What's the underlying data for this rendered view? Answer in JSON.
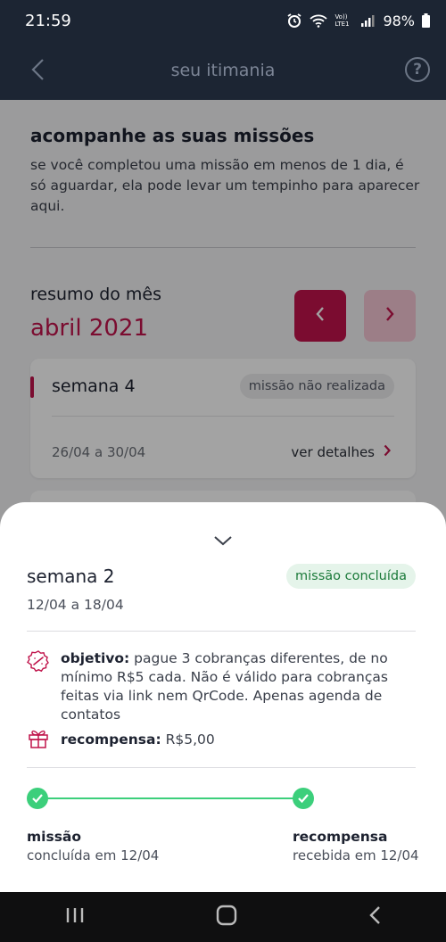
{
  "status_bar": {
    "time": "21:59",
    "signal_label": "Vo)) LTE1",
    "battery": "98%"
  },
  "app_bar": {
    "title": "seu itimania"
  },
  "intro": {
    "title": "acompanhe as suas missões",
    "description": "se você completou uma missão em menos de 1 dia, é só aguardar, ela pode levar um tempinho para aparecer aqui."
  },
  "summary": {
    "label": "resumo do mês",
    "month": "abril 2021"
  },
  "week_card": {
    "title": "semana 4",
    "status": "missão não realizada",
    "dates": "26/04 a 30/04",
    "link": "ver detalhes"
  },
  "sheet": {
    "title": "semana 2",
    "status": "missão concluída",
    "dates": "12/04 a 18/04",
    "objective_label": "objetivo:",
    "objective_text": " pague 3 cobranças diferentes, de no mínimo R$5 cada. Não é válido para cobranças feitas via link nem QrCode. Apenas agenda de contatos",
    "reward_label": "recompensa:",
    "reward_value": " R$5,00",
    "steps": [
      {
        "label": "missão",
        "sub": "concluída em 12/04"
      },
      {
        "label": "recompensa",
        "sub": "recebida em 12/04"
      }
    ]
  },
  "colors": {
    "accent": "#c0144b",
    "success": "#3ccf7b",
    "header": "#1c2533"
  }
}
